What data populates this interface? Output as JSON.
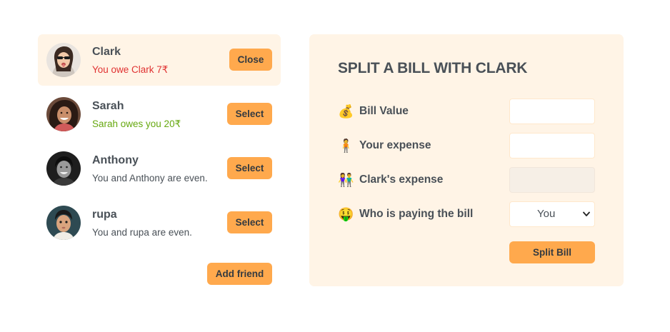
{
  "friends": [
    {
      "name": "Clark",
      "status": "You owe Clark 7₹",
      "status_type": "owe",
      "button": "Close",
      "selected": true
    },
    {
      "name": "Sarah",
      "status": "Sarah owes you 20₹",
      "status_type": "owed",
      "button": "Select",
      "selected": false
    },
    {
      "name": "Anthony",
      "status": "You and Anthony are even.",
      "status_type": "even",
      "button": "Select",
      "selected": false
    },
    {
      "name": "rupa",
      "status": "You and rupa are even.",
      "status_type": "even",
      "button": "Select",
      "selected": false
    }
  ],
  "add_friend_label": "Add friend",
  "split": {
    "title": "SPLIT A BILL WITH CLARK",
    "bill_value": {
      "emoji": "💰",
      "label": "Bill Value",
      "value": ""
    },
    "your_expense": {
      "emoji": "🧍",
      "label": "Your expense",
      "value": ""
    },
    "friend_expense": {
      "emoji": "👫",
      "label": "Clark's expense",
      "value": ""
    },
    "payer": {
      "emoji": "🤑",
      "label": "Who is paying the bill",
      "selected": "You"
    },
    "submit_label": "Split Bill"
  },
  "colors": {
    "accent": "#ffa94d",
    "panel_bg": "#fff4e6",
    "owe": "#e03131",
    "owed": "#66a80f",
    "text": "#495057"
  }
}
